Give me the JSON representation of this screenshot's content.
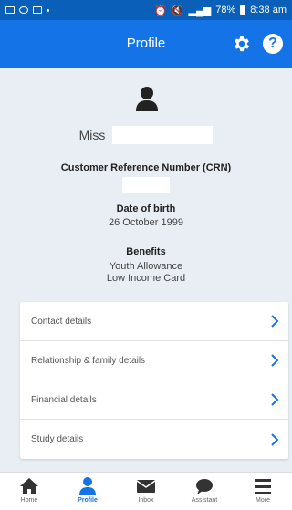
{
  "statusbar": {
    "battery": "78%",
    "time": "8:38 am"
  },
  "header": {
    "title": "Profile",
    "settings_icon": "gear-icon",
    "help_icon": "help-icon",
    "help_symbol": "?"
  },
  "profile": {
    "title": "Miss",
    "crn_label": "Customer Reference Number (CRN)",
    "dob_label": "Date of birth",
    "dob_value": "26 October 1999",
    "benefits_label": "Benefits",
    "benefits": [
      "Youth Allowance",
      "Low Income Card"
    ]
  },
  "menu": {
    "items": [
      {
        "label": "Contact details"
      },
      {
        "label": "Relationship & family details"
      },
      {
        "label": "Financial details"
      },
      {
        "label": "Study details"
      }
    ]
  },
  "nav": {
    "items": [
      {
        "label": "Home",
        "icon": "home-icon"
      },
      {
        "label": "Profile",
        "icon": "profile-icon",
        "active": true
      },
      {
        "label": "Inbox",
        "icon": "inbox-icon"
      },
      {
        "label": "Assistant",
        "icon": "chat-icon"
      },
      {
        "label": "More",
        "icon": "menu-icon"
      }
    ]
  },
  "colors": {
    "primary": "#1473e6",
    "statusbar": "#0a5fb8",
    "background": "#e9eef5"
  }
}
